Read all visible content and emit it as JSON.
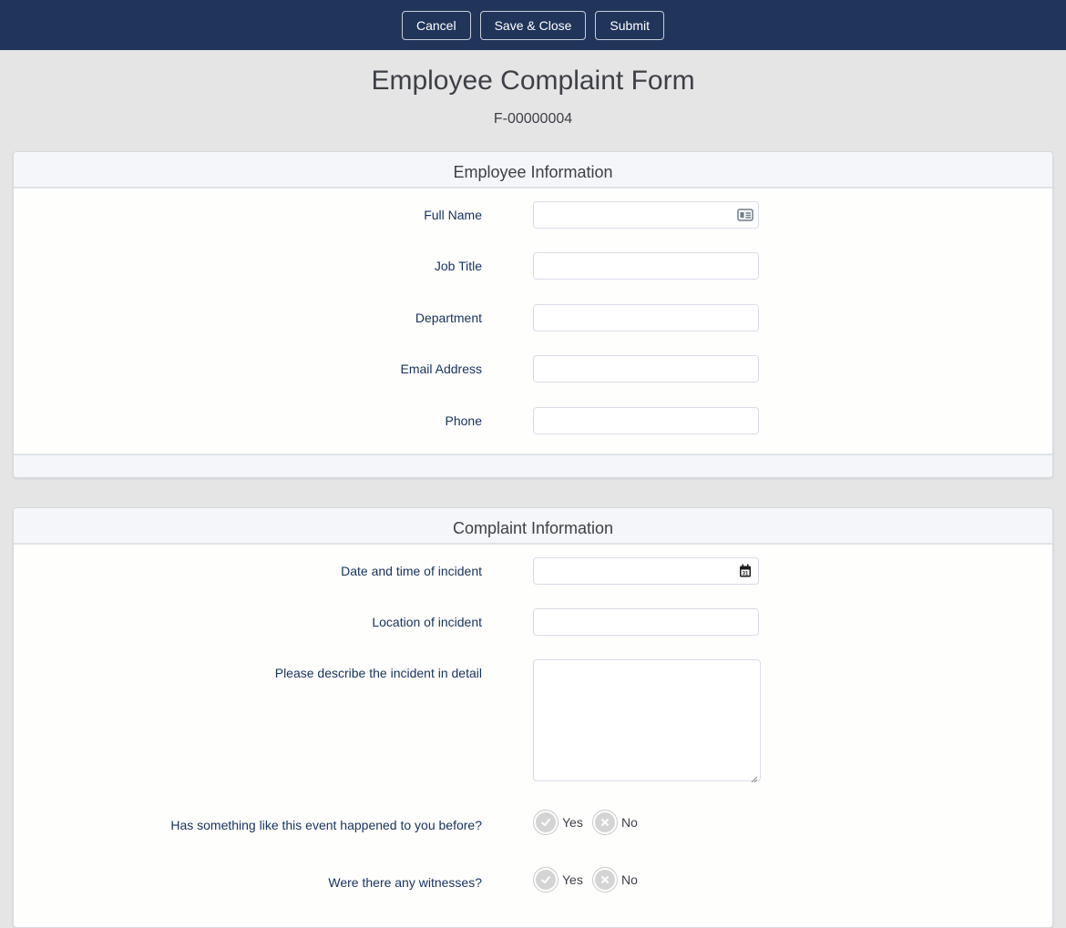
{
  "toolbar": {
    "cancel_label": "Cancel",
    "save_close_label": "Save & Close",
    "submit_label": "Submit"
  },
  "form": {
    "title": "Employee Complaint Form",
    "id": "F-00000004"
  },
  "employee_section": {
    "title": "Employee Information",
    "fields": {
      "full_name": {
        "label": "Full Name",
        "value": "",
        "icon": "contact-card-icon"
      },
      "job_title": {
        "label": "Job Title",
        "value": ""
      },
      "department": {
        "label": "Department",
        "value": ""
      },
      "email": {
        "label": "Email Address",
        "value": ""
      },
      "phone": {
        "label": "Phone",
        "value": ""
      }
    }
  },
  "complaint_section": {
    "title": "Complaint Information",
    "fields": {
      "datetime": {
        "label": "Date and time of incident",
        "value": "",
        "icon": "calendar-icon",
        "icon_text": "31"
      },
      "location": {
        "label": "Location of incident",
        "value": ""
      },
      "description": {
        "label": "Please describe the incident in detail",
        "value": ""
      },
      "happened_before": {
        "label": "Has something like this event happened to you before?",
        "yes_label": "Yes",
        "no_label": "No",
        "selected": null
      },
      "witnesses": {
        "label": "Were there any witnesses?",
        "yes_label": "Yes",
        "no_label": "No",
        "selected": null
      }
    }
  },
  "colors": {
    "topbar": "#21355b",
    "label_text": "#16325c",
    "page_bg": "#e5e5e6"
  }
}
